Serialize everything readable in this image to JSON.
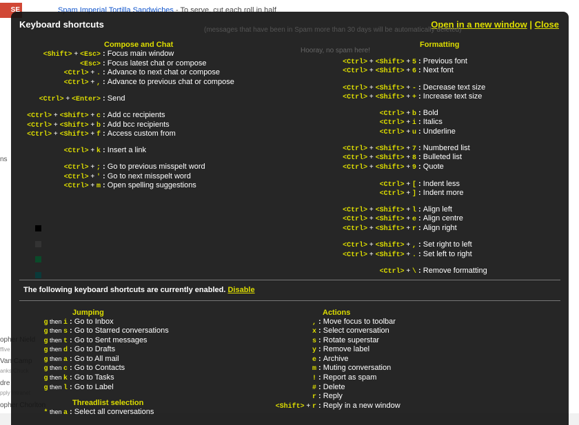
{
  "background": {
    "compose_label": "SE",
    "email_line_link": "Spam Imperial Tortilla Sandwiches",
    "email_line_text": " - To serve, cut each roll in half",
    "spam_notice": "(messages that have been in Spam more than 30 days will be automatically deleted)",
    "no_spam": "Hooray, no spam here!",
    "side_ns": "ns",
    "contacts": [
      {
        "name": "opher Nield",
        "sub": "ffive"
      },
      {
        "name": "Van Camp",
        "sub": "anks Chuck"
      },
      {
        "name": "dre",
        "sub": "pply Intranet"
      },
      {
        "name": "opher Chorlton",
        "sub": ""
      }
    ]
  },
  "overlay": {
    "title": "Keyboard shortcuts",
    "open_window_label": "Open in a new window",
    "separator": "|",
    "close_label": "Close",
    "enabled_text": "The following keyboard shortcuts are currently enabled.",
    "disable_label": "Disable"
  },
  "compose": {
    "heading": "Compose and Chat",
    "items": [
      {
        "keys": [
          "<Shift>",
          "<Esc>"
        ],
        "desc": "Focus main window"
      },
      {
        "keys": [
          "<Esc>"
        ],
        "desc": "Focus latest chat or compose"
      },
      {
        "keys": [
          "<Ctrl>",
          "."
        ],
        "desc": "Advance to next chat or compose"
      },
      {
        "keys": [
          "<Ctrl>",
          ","
        ],
        "desc": "Advance to previous chat or compose"
      },
      {
        "keys": [
          "<Ctrl>",
          "<Enter>"
        ],
        "desc": "Send"
      },
      {
        "keys": [
          "<Ctrl>",
          "<Shift>",
          "c"
        ],
        "desc": "Add cc recipients"
      },
      {
        "keys": [
          "<Ctrl>",
          "<Shift>",
          "b"
        ],
        "desc": "Add bcc recipients"
      },
      {
        "keys": [
          "<Ctrl>",
          "<Shift>",
          "f"
        ],
        "desc": "Access custom from"
      },
      {
        "keys": [
          "<Ctrl>",
          "k"
        ],
        "desc": "Insert a link"
      },
      {
        "keys": [
          "<Ctrl>",
          ";"
        ],
        "desc": "Go to previous misspelt word"
      },
      {
        "keys": [
          "<Ctrl>",
          "'"
        ],
        "desc": "Go to next misspelt word"
      },
      {
        "keys": [
          "<Ctrl>",
          "m"
        ],
        "desc": "Open spelling suggestions"
      }
    ]
  },
  "formatting": {
    "heading": "Formatting",
    "items": [
      {
        "keys": [
          "<Ctrl>",
          "<Shift>",
          "5"
        ],
        "desc": "Previous font"
      },
      {
        "keys": [
          "<Ctrl>",
          "<Shift>",
          "6"
        ],
        "desc": "Next font"
      },
      {
        "keys": [
          "<Ctrl>",
          "<Shift>",
          "-"
        ],
        "desc": "Decrease text size"
      },
      {
        "keys": [
          "<Ctrl>",
          "<Shift>",
          "+"
        ],
        "desc": "Increase text size"
      },
      {
        "keys": [
          "<Ctrl>",
          "b"
        ],
        "desc": "Bold"
      },
      {
        "keys": [
          "<Ctrl>",
          "i"
        ],
        "desc": "Italics"
      },
      {
        "keys": [
          "<Ctrl>",
          "u"
        ],
        "desc": "Underline"
      },
      {
        "keys": [
          "<Ctrl>",
          "<Shift>",
          "7"
        ],
        "desc": "Numbered list"
      },
      {
        "keys": [
          "<Ctrl>",
          "<Shift>",
          "8"
        ],
        "desc": "Bulleted list"
      },
      {
        "keys": [
          "<Ctrl>",
          "<Shift>",
          "9"
        ],
        "desc": "Quote"
      },
      {
        "keys": [
          "<Ctrl>",
          "["
        ],
        "desc": "Indent less"
      },
      {
        "keys": [
          "<Ctrl>",
          "]"
        ],
        "desc": "Indent more"
      },
      {
        "keys": [
          "<Ctrl>",
          "<Shift>",
          "l"
        ],
        "desc": "Align left"
      },
      {
        "keys": [
          "<Ctrl>",
          "<Shift>",
          "e"
        ],
        "desc": "Align centre"
      },
      {
        "keys": [
          "<Ctrl>",
          "<Shift>",
          "r"
        ],
        "desc": "Align right"
      },
      {
        "keys": [
          "<Ctrl>",
          "<Shift>",
          ","
        ],
        "desc": "Set right to left"
      },
      {
        "keys": [
          "<Ctrl>",
          "<Shift>",
          "."
        ],
        "desc": "Set left to right"
      },
      {
        "keys": [
          "<Ctrl>",
          "\\"
        ],
        "desc": "Remove formatting"
      }
    ]
  },
  "jumping": {
    "heading": "Jumping",
    "then_word": "then",
    "items": [
      {
        "keys": [
          "g",
          "i"
        ],
        "desc": "Go to Inbox"
      },
      {
        "keys": [
          "g",
          "s"
        ],
        "desc": "Go to Starred conversations"
      },
      {
        "keys": [
          "g",
          "t"
        ],
        "desc": "Go to Sent messages"
      },
      {
        "keys": [
          "g",
          "d"
        ],
        "desc": "Go to Drafts"
      },
      {
        "keys": [
          "g",
          "a"
        ],
        "desc": "Go to All mail"
      },
      {
        "keys": [
          "g",
          "c"
        ],
        "desc": "Go to Contacts"
      },
      {
        "keys": [
          "g",
          "k"
        ],
        "desc": "Go to Tasks"
      },
      {
        "keys": [
          "g",
          "l"
        ],
        "desc": "Go to Label"
      }
    ]
  },
  "threadlist": {
    "heading": "Threadlist selection",
    "items": [
      {
        "keys": [
          "*",
          "a"
        ],
        "desc": "Select all conversations"
      }
    ]
  },
  "actions": {
    "heading": "Actions",
    "items": [
      {
        "keys": [
          ","
        ],
        "desc": "Move focus to toolbar"
      },
      {
        "keys": [
          "x"
        ],
        "desc": "Select conversation"
      },
      {
        "keys": [
          "s"
        ],
        "desc": "Rotate superstar"
      },
      {
        "keys": [
          "y"
        ],
        "desc": "Remove label"
      },
      {
        "keys": [
          "e"
        ],
        "desc": "Archive"
      },
      {
        "keys": [
          "m"
        ],
        "desc": "Muting conversation"
      },
      {
        "keys": [
          "!"
        ],
        "desc": "Report as spam"
      },
      {
        "keys": [
          "#"
        ],
        "desc": "Delete"
      },
      {
        "keys": [
          "r"
        ],
        "desc": "Reply"
      },
      {
        "keys": [
          "<Shift>",
          "r"
        ],
        "desc": "Reply in a new window"
      }
    ]
  },
  "colors": {
    "accent_yellow": "#dddd00",
    "overlay_bg": "#141414",
    "compose_red": "#d14836"
  }
}
